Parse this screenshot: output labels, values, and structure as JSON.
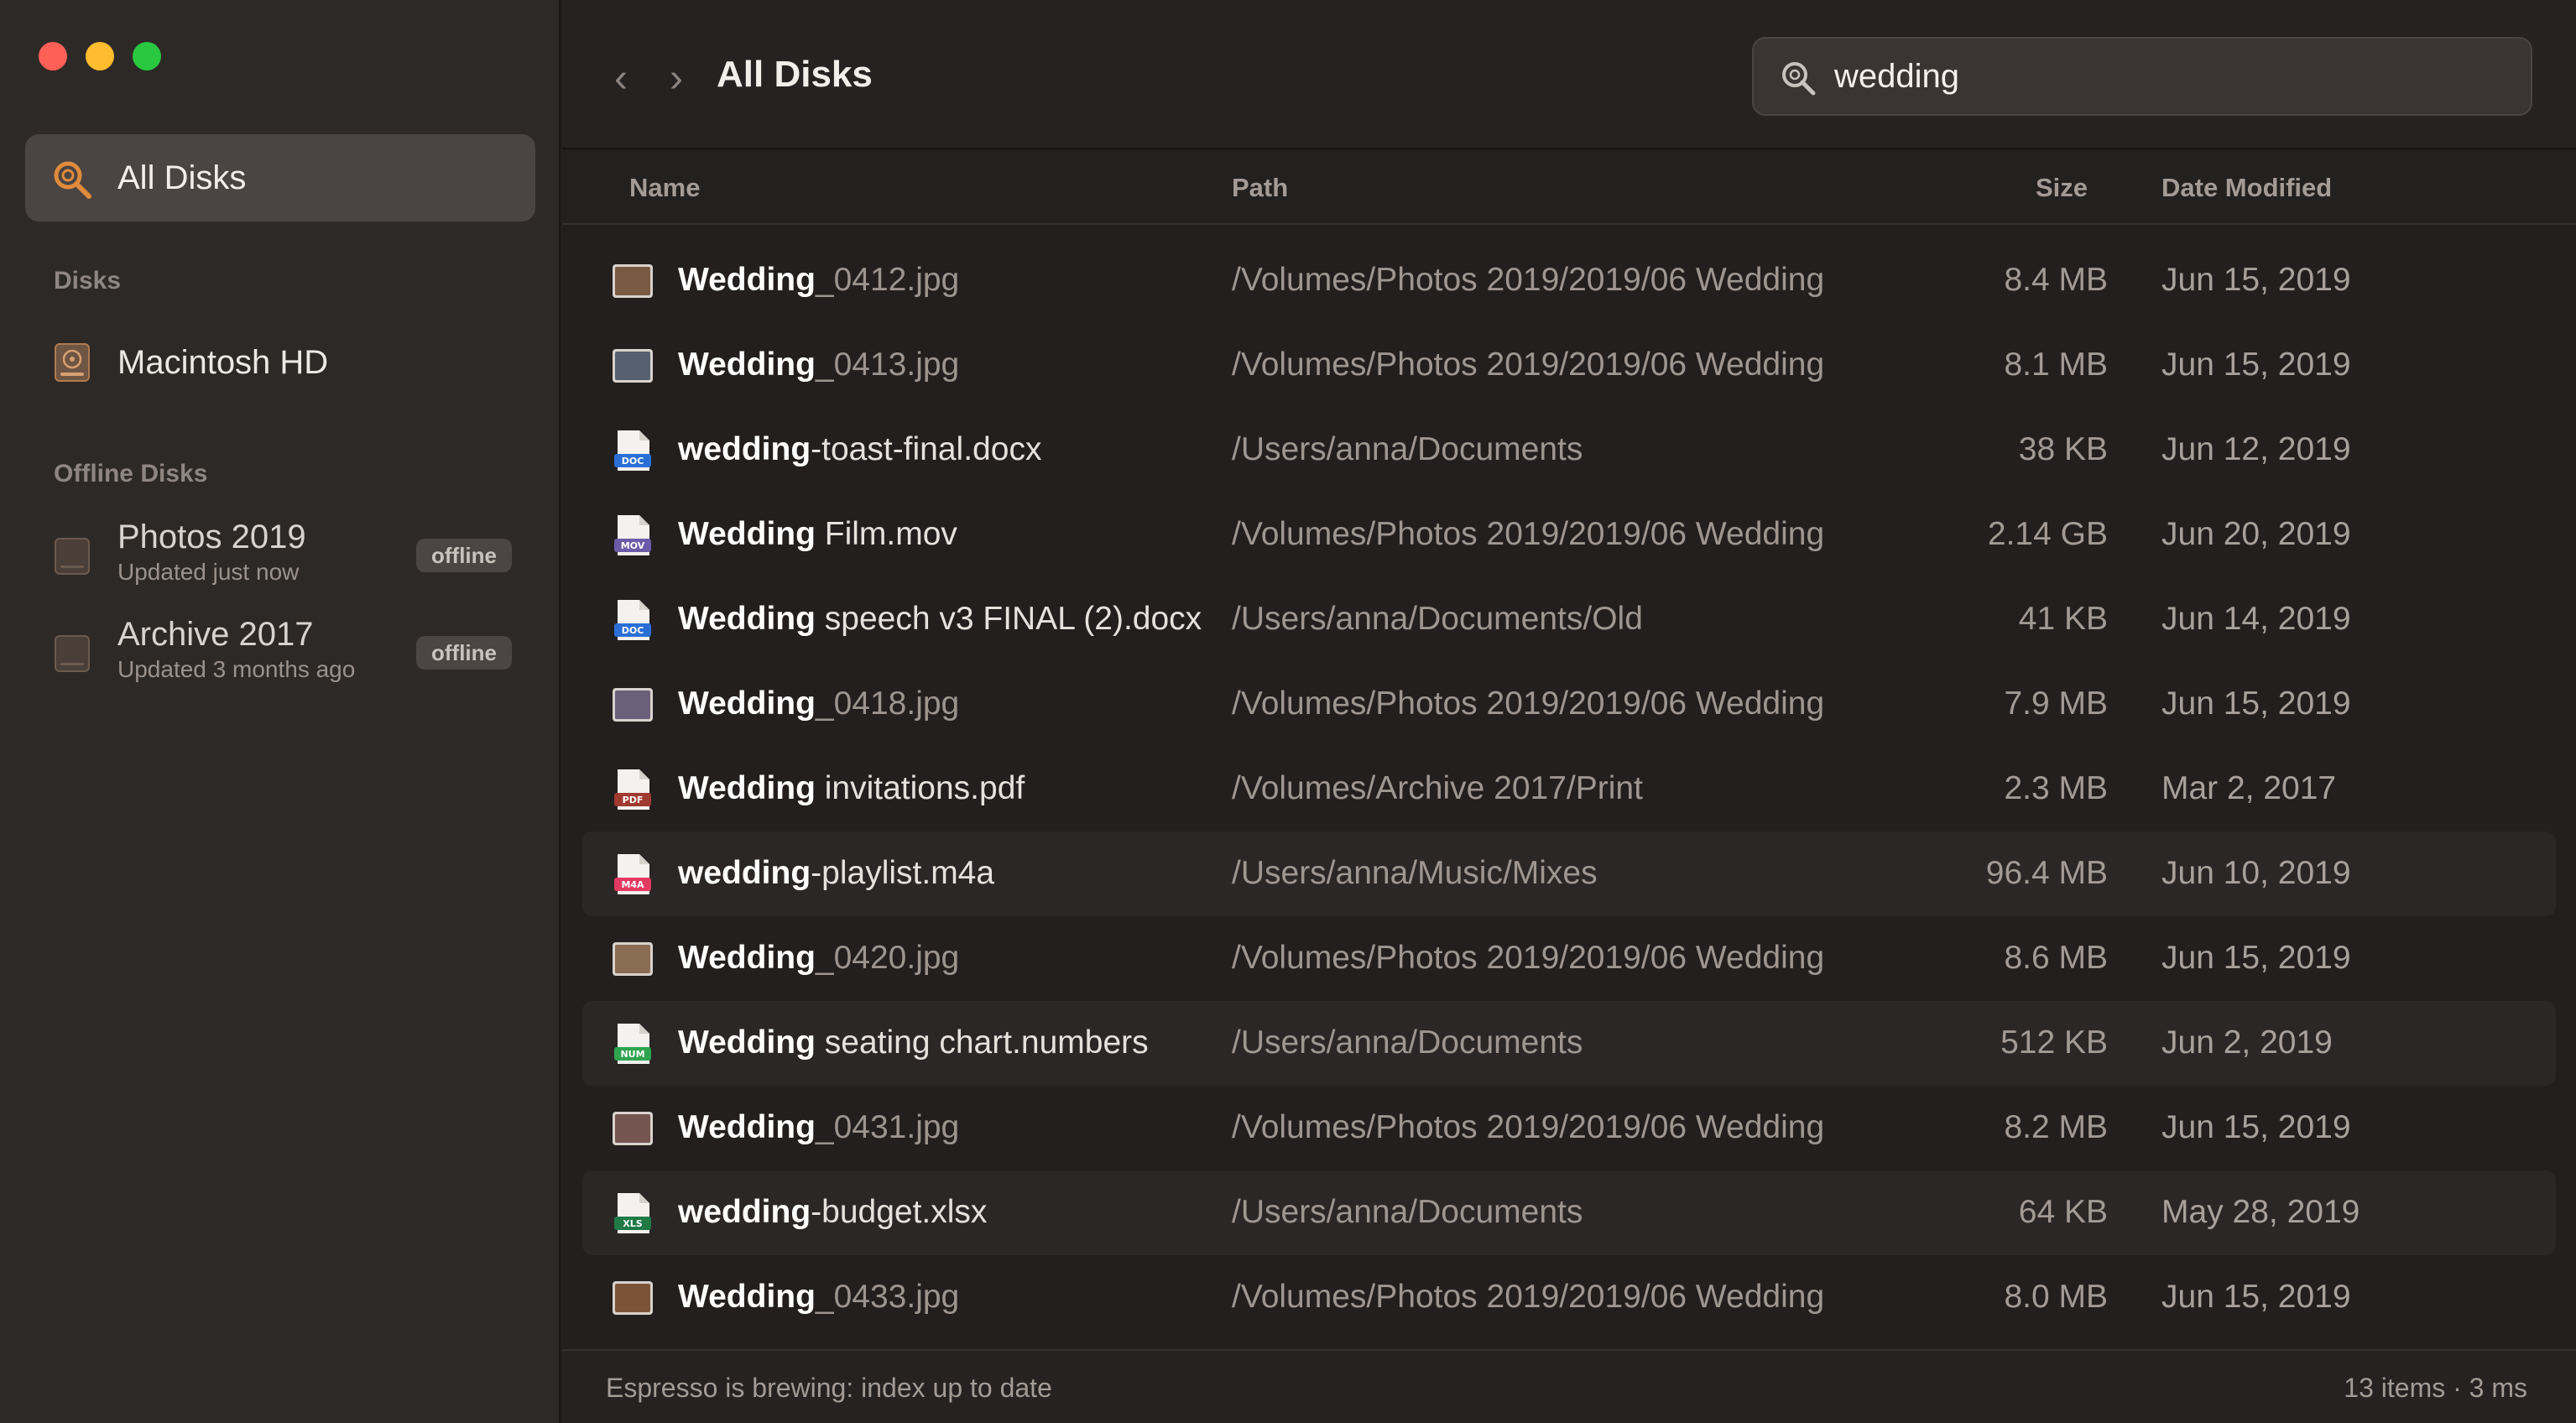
{
  "sidebar": {
    "all_disks_label": "All Disks",
    "disks_heading": "Disks",
    "disks": [
      {
        "label": "Macintosh HD"
      }
    ],
    "offline_heading": "Offline Disks",
    "offline_disks": [
      {
        "label": "Photos 2019",
        "sub": "Updated just now",
        "badge": "offline"
      },
      {
        "label": "Archive 2017",
        "sub": "Updated 3 months ago",
        "badge": "offline"
      }
    ]
  },
  "toolbar": {
    "back_glyph": "‹",
    "forward_glyph": "›",
    "title": "All Disks",
    "search_value": "wedding"
  },
  "table": {
    "headers": {
      "name": "Name",
      "path": "Path",
      "size": "Size",
      "date": "Date Modified"
    },
    "rows": [
      {
        "icon": "image-thumbnail-icon",
        "thumb": "#7a5a42",
        "hl": "Wedding",
        "rest": "_0412.jpg",
        "path": "/Volumes/Photos 2019/2019/06 Wedding",
        "size": "8.4 MB",
        "date": "Jun 15, 2019"
      },
      {
        "icon": "image-thumbnail-icon",
        "thumb": "#55616f",
        "hl": "Wedding",
        "rest": "_0413.jpg",
        "path": "/Volumes/Photos 2019/2019/06 Wedding",
        "size": "8.1 MB",
        "date": "Jun 15, 2019"
      },
      {
        "icon": "doc-file-icon",
        "tag": "DOC",
        "tagcolor": "#2b6fd6",
        "hl": "wedding",
        "rest": "-toast-final.docx",
        "path": "/Users/anna/Documents",
        "size": "38 KB",
        "date": "Jun 12, 2019"
      },
      {
        "icon": "mov-file-icon",
        "tag": "MOV",
        "tagcolor": "#6b5ca8",
        "hl": "Wedding",
        "rest": " Film.mov",
        "path": "/Volumes/Photos 2019/2019/06 Wedding",
        "size": "2.14 GB",
        "date": "Jun 20, 2019"
      },
      {
        "icon": "doc-file-icon",
        "tag": "DOC",
        "tagcolor": "#2b6fd6",
        "hl": "Wedding",
        "rest": " speech v3 FINAL (2).docx",
        "path": "/Users/anna/Documents/Old",
        "size": "41 KB",
        "date": "Jun 14, 2019"
      },
      {
        "icon": "image-thumbnail-icon",
        "thumb": "#6b5f7a",
        "hl": "Wedding",
        "rest": "_0418.jpg",
        "path": "/Volumes/Photos 2019/2019/06 Wedding",
        "size": "7.9 MB",
        "date": "Jun 15, 2019"
      },
      {
        "icon": "pdf-file-icon",
        "tag": "PDF",
        "tagcolor": "#a0392f",
        "hl": "Wedding",
        "rest": " invitations.pdf",
        "path": "/Volumes/Archive 2017/Print",
        "size": "2.3 MB",
        "date": "Mar 2, 2017"
      },
      {
        "icon": "audio-file-icon",
        "tag": "M4A",
        "tagcolor": "#e33a62",
        "hl": "wedding",
        "rest": "-playlist.m4a",
        "path": "/Users/anna/Music/Mixes",
        "size": "96.4 MB",
        "date": "Jun 10, 2019"
      },
      {
        "icon": "image-thumbnail-icon",
        "thumb": "#8a6d52",
        "hl": "Wedding",
        "rest": "_0420.jpg",
        "path": "/Volumes/Photos 2019/2019/06 Wedding",
        "size": "8.6 MB",
        "date": "Jun 15, 2019"
      },
      {
        "icon": "numbers-file-icon",
        "tag": "NUM",
        "tagcolor": "#2ea44f",
        "hl": "Wedding",
        "rest": " seating chart.numbers",
        "path": "/Users/anna/Documents",
        "size": "512 KB",
        "date": "Jun 2, 2019"
      },
      {
        "icon": "image-thumbnail-icon",
        "thumb": "#74554f",
        "hl": "Wedding",
        "rest": "_0431.jpg",
        "path": "/Volumes/Photos 2019/2019/06 Wedding",
        "size": "8.2 MB",
        "date": "Jun 15, 2019"
      },
      {
        "icon": "excel-file-icon",
        "tag": "XLS",
        "tagcolor": "#1f7a45",
        "hl": "wedding",
        "rest": "-budget.xlsx",
        "path": "/Users/anna/Documents",
        "size": "64 KB",
        "date": "May 28, 2019"
      },
      {
        "icon": "image-thumbnail-icon",
        "thumb": "#7b5438",
        "hl": "Wedding",
        "rest": "_0433.jpg",
        "path": "/Volumes/Photos 2019/2019/06 Wedding",
        "size": "8.0 MB",
        "date": "Jun 15, 2019"
      }
    ]
  },
  "status": {
    "left": "Espresso is brewing: index up to date",
    "right": "13 items · 3 ms"
  },
  "colors": {
    "accent": "#e08a3c",
    "traffic_red": "#fe5f57",
    "traffic_yellow": "#febc2e",
    "traffic_green": "#28c840"
  }
}
